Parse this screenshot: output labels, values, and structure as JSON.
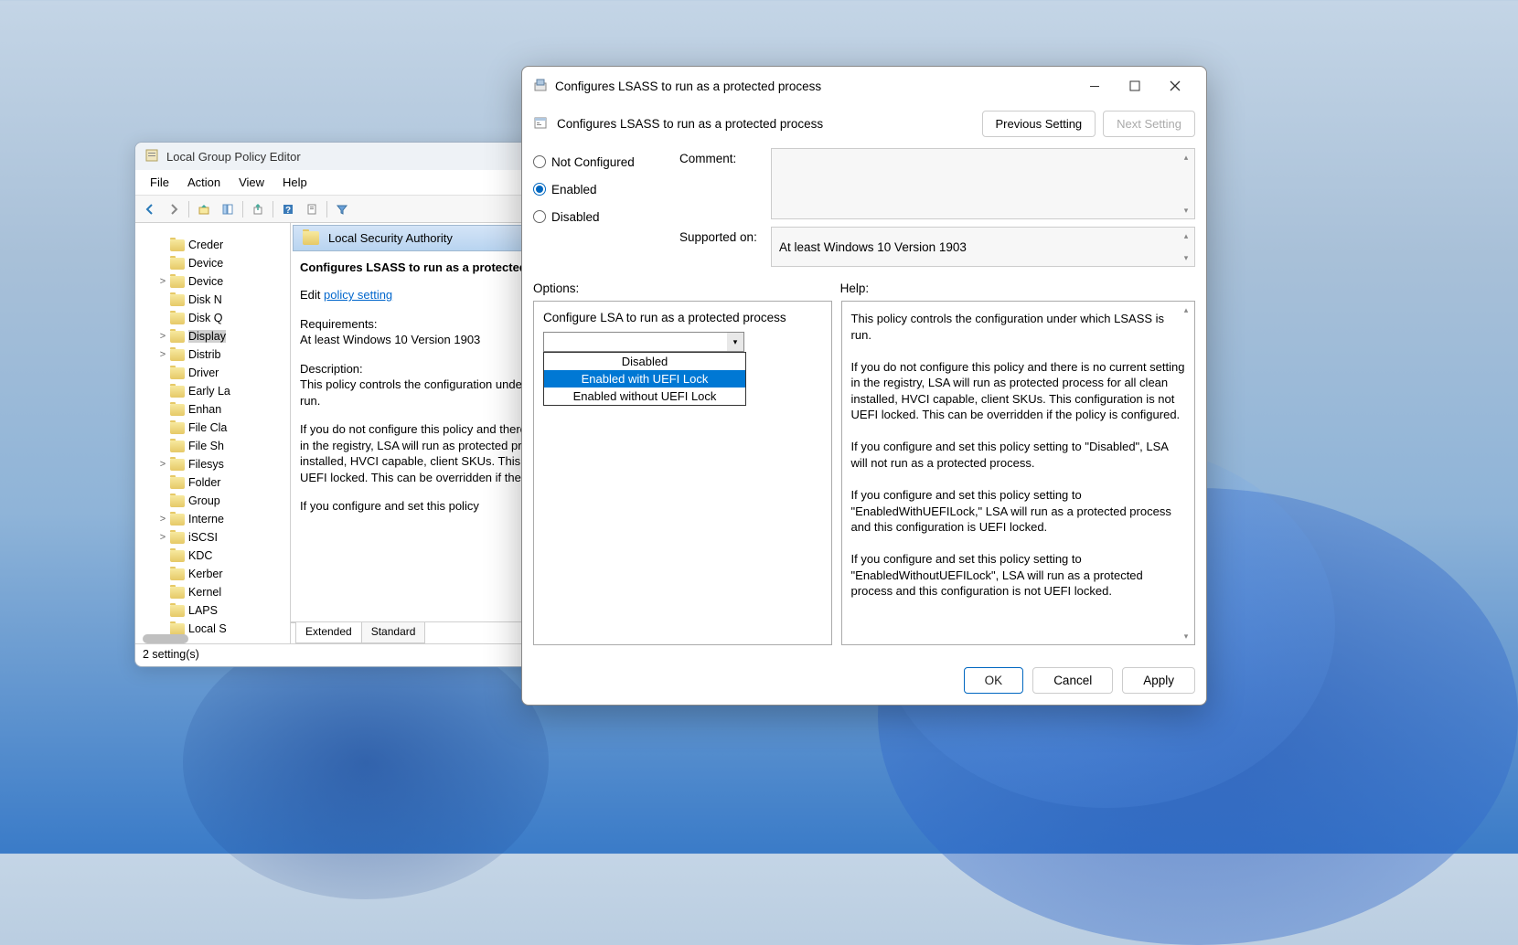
{
  "gpe": {
    "title": "Local Group Policy Editor",
    "menu": {
      "file": "File",
      "action": "Action",
      "view": "View",
      "help": "Help"
    },
    "tree": {
      "items": [
        {
          "label": "Creder",
          "exp": ""
        },
        {
          "label": "Device",
          "exp": ""
        },
        {
          "label": "Device",
          "exp": ">"
        },
        {
          "label": "Disk N",
          "exp": ""
        },
        {
          "label": "Disk Q",
          "exp": ""
        },
        {
          "label": "Display",
          "exp": ">"
        },
        {
          "label": "Distrib",
          "exp": ">"
        },
        {
          "label": "Driver",
          "exp": ""
        },
        {
          "label": "Early La",
          "exp": ""
        },
        {
          "label": "Enhan",
          "exp": ""
        },
        {
          "label": "File Cla",
          "exp": ""
        },
        {
          "label": "File Sh",
          "exp": ""
        },
        {
          "label": "Filesys",
          "exp": ">"
        },
        {
          "label": "Folder",
          "exp": ""
        },
        {
          "label": "Group",
          "exp": ""
        },
        {
          "label": "Interne",
          "exp": ">"
        },
        {
          "label": "iSCSI",
          "exp": ">"
        },
        {
          "label": "KDC",
          "exp": ""
        },
        {
          "label": "Kerber",
          "exp": ""
        },
        {
          "label": "Kernel",
          "exp": ""
        },
        {
          "label": "LAPS",
          "exp": ""
        },
        {
          "label": "Local S",
          "exp": ""
        }
      ]
    },
    "detail": {
      "header": "Local Security Authority",
      "title": "Configures LSASS to run as a protected process",
      "edit_prefix": "Edit ",
      "edit_link": "policy setting",
      "req_head": "Requirements:",
      "req_body": "At least Windows 10 Version 1903",
      "desc_head": "Description:",
      "desc_body": "This policy controls the configuration under which LSASS is run.",
      "p1": "If you do not configure this policy and there is no current setting in the registry, LSA will run as protected process for all clean installed, HVCI capable, client SKUs. This configuration is not UEFI locked. This can be overridden if the policy is configured.",
      "p2": "If you configure and set this policy"
    },
    "tabs": {
      "extended": "Extended",
      "standard": "Standard"
    },
    "status": "2 setting(s)"
  },
  "dialog": {
    "title": "Configures LSASS to run as a protected process",
    "subtitle": "Configures LSASS to run as a protected process",
    "nav": {
      "prev": "Previous Setting",
      "next": "Next Setting"
    },
    "state": {
      "not_configured": "Not Configured",
      "enabled": "Enabled",
      "disabled": "Disabled",
      "selected": "enabled"
    },
    "labels": {
      "comment": "Comment:",
      "supported": "Supported on:",
      "options": "Options:",
      "help": "Help:"
    },
    "supported_on": "At least Windows 10 Version 1903",
    "options": {
      "label": "Configure LSA to run as a protected process",
      "list": [
        {
          "text": "Disabled",
          "selected": false
        },
        {
          "text": "Enabled with UEFI Lock",
          "selected": true
        },
        {
          "text": "Enabled without UEFI Lock",
          "selected": false
        }
      ]
    },
    "help": {
      "p1": "This policy controls the configuration under which LSASS is run.",
      "p2": "If you do not configure this policy and there is no current setting in the registry, LSA will run as protected process for all clean installed, HVCI capable, client SKUs. This configuration is not UEFI locked. This can be overridden if the policy is configured.",
      "p3": "If you configure and set this policy setting to \"Disabled\", LSA will not run as a protected process.",
      "p4": "If you configure and set this policy setting to \"EnabledWithUEFILock,\" LSA will run as a protected process and this configuration is UEFI locked.",
      "p5": "If you configure and set this policy setting to \"EnabledWithoutUEFILock\", LSA will run as a protected process and this configuration is not UEFI locked."
    },
    "buttons": {
      "ok": "OK",
      "cancel": "Cancel",
      "apply": "Apply"
    },
    "colors": {
      "accent": "#0067c0",
      "selection": "#0078d4"
    }
  }
}
